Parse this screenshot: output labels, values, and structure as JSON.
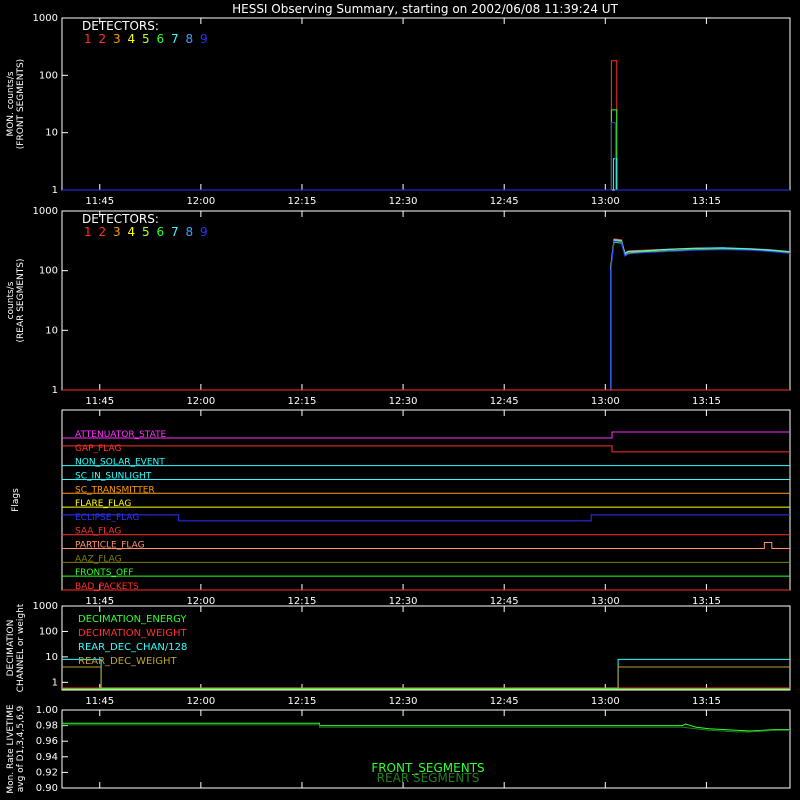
{
  "title": "HESSI Observing Summary, starting on 2002/06/08 11:39:24 UT",
  "time_ticks": [
    "11:45",
    "12:00",
    "12:15",
    "12:30",
    "12:45",
    "13:00",
    "13:15"
  ],
  "time_tick_minutes": [
    5.6,
    20.6,
    35.6,
    50.6,
    65.6,
    80.6,
    95.6
  ],
  "time_range_minutes": [
    0,
    108
  ],
  "detector_colors": [
    "#ff3030",
    "#ff3030",
    "#ff9900",
    "#ffff00",
    "#b0ff30",
    "#30ff30",
    "#30ffff",
    "#40a0ff",
    "#3030ff"
  ],
  "detectors_label": "DETECTORS:",
  "detector_numbers": [
    "1",
    "2",
    "3",
    "4",
    "5",
    "6",
    "7",
    "8",
    "9"
  ],
  "chart_data": [
    {
      "type": "line",
      "panel": "front",
      "ylabel": [
        "MON. counts/s",
        "(FRONT SEGMENTS)"
      ],
      "yscale": "log",
      "ylim": [
        1,
        1000
      ],
      "ytick_labels": [
        "1000",
        "100",
        "10",
        "1"
      ],
      "ytick_values": [
        1000,
        100,
        10,
        1
      ],
      "series": [
        {
          "color": "#ff3030",
          "x": [
            0,
            81.5,
            81.5,
            82.3,
            82.3,
            108
          ],
          "y": [
            1,
            1,
            180,
            180,
            1,
            1
          ]
        },
        {
          "color": "#30ff30",
          "x": [
            0,
            81.5,
            81.5,
            82.3,
            82.3,
            108
          ],
          "y": [
            1,
            1,
            25,
            25,
            1,
            1
          ]
        },
        {
          "color": "#30ffff",
          "x": [
            0,
            81.8,
            81.8,
            82.3,
            82.3,
            108
          ],
          "y": [
            1,
            1,
            3.5,
            3.5,
            1,
            1
          ]
        },
        {
          "color": "#3030ff",
          "x": [
            0,
            81.5,
            81.5,
            82.1,
            82.1,
            108
          ],
          "y": [
            1,
            1,
            15,
            15,
            1,
            1
          ]
        }
      ]
    },
    {
      "type": "line",
      "panel": "rear",
      "ylabel": [
        "counts/s",
        "(REAR SEGMENTS)"
      ],
      "yscale": "log",
      "ylim": [
        1,
        1000
      ],
      "ytick_labels": [
        "1000",
        "100",
        "10",
        "1"
      ],
      "ytick_values": [
        1000,
        100,
        10,
        1
      ],
      "series": [
        {
          "color": "#ff3030",
          "x": [
            0,
            81.4,
            81.4,
            81.9,
            83,
            83.5,
            84,
            86,
            90,
            94,
            98,
            102,
            105,
            108
          ],
          "y": [
            1,
            1,
            120,
            340,
            330,
            200,
            215,
            220,
            230,
            240,
            240,
            235,
            225,
            210
          ]
        },
        {
          "color": "#ff9900",
          "x": [
            0,
            81.4,
            81.4,
            81.9,
            83,
            83.5,
            84,
            86,
            90,
            94,
            98,
            102,
            105,
            108
          ],
          "y": [
            1,
            1,
            110,
            320,
            310,
            190,
            205,
            210,
            225,
            235,
            238,
            230,
            220,
            205
          ]
        },
        {
          "color": "#30ff30",
          "x": [
            0,
            81.4,
            81.4,
            81.9,
            83,
            83.5,
            84,
            86,
            90,
            94,
            98,
            102,
            105,
            108
          ],
          "y": [
            1,
            1,
            105,
            300,
            290,
            180,
            195,
            205,
            215,
            225,
            230,
            225,
            215,
            200
          ]
        },
        {
          "color": "#30ffff",
          "x": [
            0,
            81.4,
            81.4,
            81.9,
            83,
            83.5,
            84,
            86,
            90,
            94,
            98,
            102,
            105,
            108
          ],
          "y": [
            1,
            1,
            115,
            330,
            320,
            195,
            210,
            215,
            228,
            238,
            242,
            232,
            222,
            208
          ]
        },
        {
          "color": "#3030ff",
          "x": [
            0,
            81.4,
            81.4,
            81.9,
            83,
            83.5,
            84,
            86,
            90,
            94,
            98,
            102,
            105,
            108
          ],
          "y": [
            1,
            1,
            100,
            310,
            300,
            175,
            190,
            200,
            210,
            220,
            225,
            220,
            210,
            195
          ]
        },
        {
          "color": "#ff3030",
          "x": [
            0,
            81.3,
            81.3,
            108
          ],
          "y": [
            1,
            1,
            1,
            1
          ]
        }
      ]
    },
    {
      "type": "line",
      "panel": "flags",
      "ylabel": [
        "Flags"
      ],
      "flags": [
        {
          "label": "ATTENUATOR_STATE",
          "color": "#ff30ff",
          "x": [
            0,
            81.6,
            81.6,
            108
          ],
          "s": [
            0,
            0,
            1,
            1
          ]
        },
        {
          "label": "GAP_FLAG",
          "color": "#ff3030",
          "x": [
            0,
            81.6,
            81.6,
            108
          ],
          "s": [
            1,
            1,
            0,
            0
          ]
        },
        {
          "label": "NON_SOLAR_EVENT",
          "color": "#30ffff",
          "x": [
            0,
            108
          ],
          "s": [
            0,
            0
          ]
        },
        {
          "label": "SC_IN_SUNLIGHT",
          "color": "#30ffff",
          "x": [
            0,
            108
          ],
          "s": [
            0,
            0
          ]
        },
        {
          "label": "SC_TRANSMITTER",
          "color": "#ff9900",
          "x": [
            0,
            108
          ],
          "s": [
            0,
            0
          ]
        },
        {
          "label": "FLARE_FLAG",
          "color": "#ffff00",
          "x": [
            0,
            108
          ],
          "s": [
            0,
            0
          ]
        },
        {
          "label": "ECLIPSE_FLAG",
          "color": "#3030ff",
          "x": [
            0,
            17.3,
            17.3,
            78.5,
            78.5,
            108
          ],
          "s": [
            1,
            1,
            0,
            0,
            1,
            1
          ]
        },
        {
          "label": "SAA_FLAG",
          "color": "#ff3030",
          "x": [
            0,
            108
          ],
          "s": [
            0,
            0
          ]
        },
        {
          "label": "PARTICLE_FLAG",
          "color": "#ff9070",
          "x": [
            0,
            104.2,
            104.2,
            105.3,
            105.3,
            108
          ],
          "s": [
            0,
            0,
            1,
            1,
            0,
            0
          ]
        },
        {
          "label": "AAZ_FLAG",
          "color": "#808000",
          "x": [
            0,
            108
          ],
          "s": [
            0,
            0
          ]
        },
        {
          "label": "FRONTS_OFF",
          "color": "#30ff30",
          "x": [
            0,
            108
          ],
          "s": [
            0,
            0
          ]
        },
        {
          "label": "BAD_PACKETS",
          "color": "#ff3030",
          "x": [
            0,
            108
          ],
          "s": [
            0,
            0
          ]
        }
      ]
    },
    {
      "type": "line",
      "panel": "decimation",
      "ylabel": [
        "DECIMATION",
        "CHANNEL or weight"
      ],
      "yscale": "log",
      "ylim": [
        0.5,
        1000
      ],
      "ytick_labels": [
        "1000",
        "100",
        "10",
        "1"
      ],
      "ytick_values": [
        1000,
        100,
        10,
        1
      ],
      "series": [
        {
          "name": "DECIMATION_ENERGY",
          "color": "#30ff30",
          "x": [
            0,
            108
          ],
          "y": [
            0.55,
            0.55
          ]
        },
        {
          "name": "DECIMATION_WEIGHT",
          "color": "#ff3030",
          "x": [
            0,
            108
          ],
          "y": [
            0.6,
            0.6
          ]
        },
        {
          "name": "REAR_DEC_CHAN/128",
          "color": "#30ffff",
          "x": [
            0,
            5.8,
            5.8,
            82.5,
            82.5,
            108
          ],
          "y": [
            8,
            8,
            0.6,
            0.6,
            8,
            8
          ]
        },
        {
          "name": "REAR_DEC_WEIGHT",
          "color": "#c0a030",
          "x": [
            0,
            5.8,
            5.8,
            82.5,
            82.5,
            108
          ],
          "y": [
            4,
            4,
            0.6,
            0.6,
            4,
            4
          ]
        }
      ]
    },
    {
      "type": "line",
      "panel": "livetime",
      "ylabel": [
        "Mon. Rate LIVETIME",
        "avg of D1,3,4,5,6,9"
      ],
      "ylim": [
        0.9,
        1.0
      ],
      "ytick_labels": [
        "1.00",
        "0.98",
        "0.96",
        "0.94",
        "0.92",
        "0.90"
      ],
      "ytick_values": [
        1.0,
        0.98,
        0.96,
        0.94,
        0.92,
        0.9
      ],
      "series": [
        {
          "name": "FRONT_SEGMENTS",
          "color": "#30ff30",
          "x": [
            0,
            38.2,
            38.2,
            92,
            92.5,
            94,
            96,
            98,
            100,
            102,
            104,
            106,
            108
          ],
          "y": [
            0.983,
            0.983,
            0.98,
            0.98,
            0.982,
            0.978,
            0.976,
            0.975,
            0.974,
            0.973,
            0.974,
            0.975,
            0.975
          ]
        },
        {
          "name": "REAR SEGMENTS",
          "color": "#208020",
          "x": [
            0,
            38.2,
            38.2,
            92,
            94,
            96,
            98,
            100,
            102,
            104,
            106,
            108
          ],
          "y": [
            0.981,
            0.981,
            0.978,
            0.978,
            0.976,
            0.974,
            0.973,
            0.972,
            0.972,
            0.973,
            0.974,
            0.974
          ]
        }
      ]
    }
  ]
}
